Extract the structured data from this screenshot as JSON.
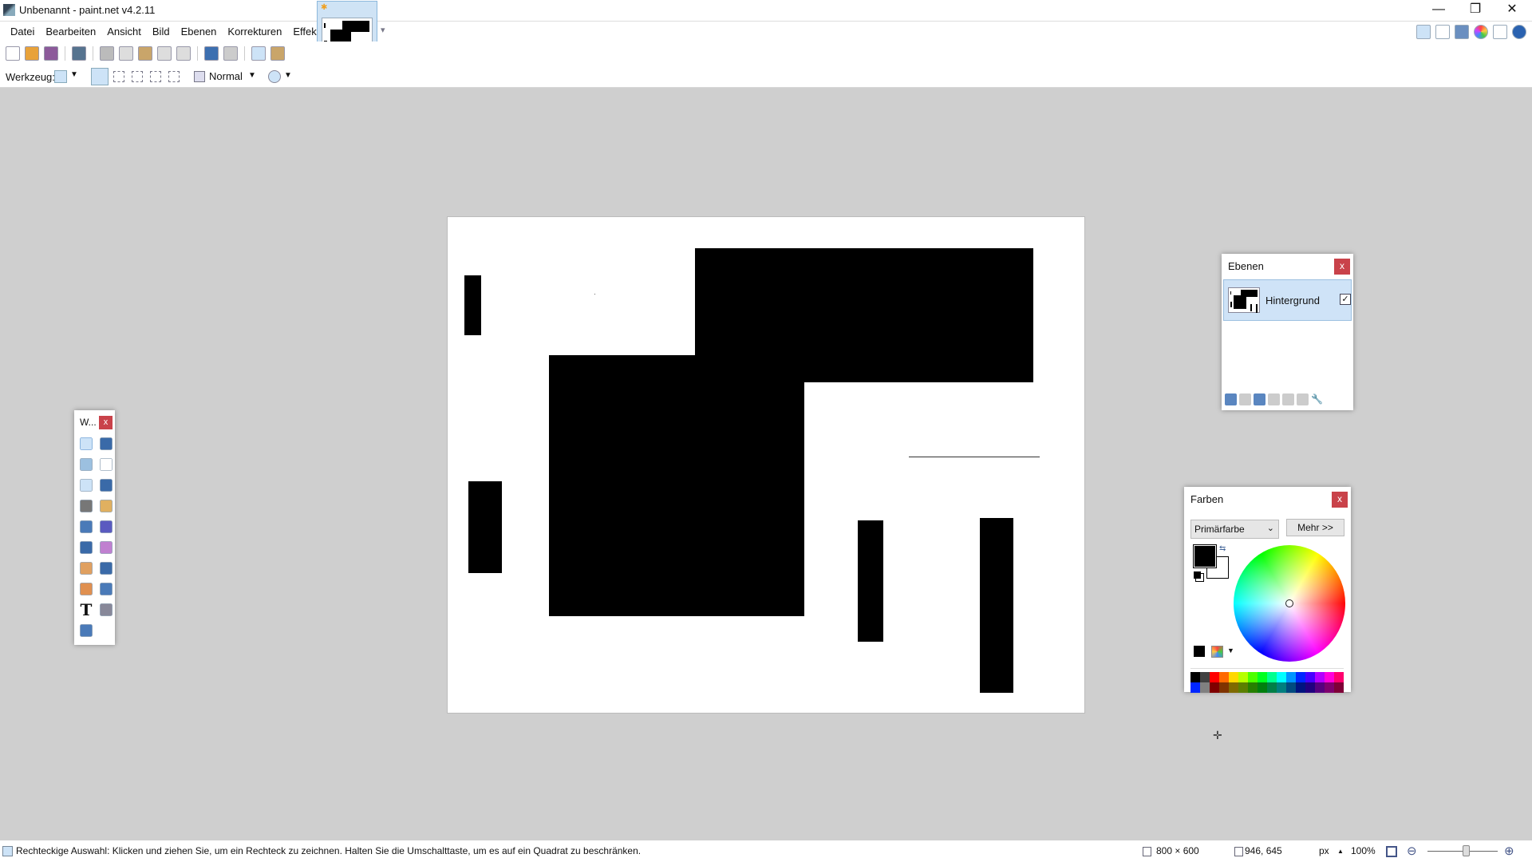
{
  "window": {
    "title": "Unbenannt - paint.net v4.2.11",
    "minimize": "—",
    "restore": "❐",
    "close": "✕"
  },
  "menu": [
    {
      "label": "Datei"
    },
    {
      "label": "Bearbeiten"
    },
    {
      "label": "Ansicht"
    },
    {
      "label": "Bild"
    },
    {
      "label": "Ebenen"
    },
    {
      "label": "Korrekturen"
    },
    {
      "label": "Effekte"
    }
  ],
  "toolbar": {
    "icons": [
      "new-file",
      "open-file",
      "save",
      "print",
      "cut",
      "copy",
      "paste",
      "crop",
      "delete",
      "undo",
      "redo",
      "grid",
      "ruler"
    ],
    "tool_label": "Werkzeug:",
    "blend_mode": "Normal"
  },
  "top_right_icons": [
    "tools-window",
    "history-window",
    "layers-window",
    "colors-window",
    "settings",
    "help"
  ],
  "layers_panel": {
    "title": "Ebenen",
    "close": "x",
    "layers": [
      {
        "name": "Hintergrund",
        "visible": true
      }
    ],
    "buttons": [
      "add-layer",
      "delete-layer",
      "duplicate-layer",
      "merge-layer-down",
      "move-layer-up",
      "move-layer-down",
      "layer-properties"
    ]
  },
  "colors_panel": {
    "title": "Farben",
    "close": "x",
    "mode": "Primärfarbe",
    "more": "Mehr >>",
    "primary": "#000000",
    "secondary": "#ffffff",
    "palette_top": [
      "#000000",
      "#404040",
      "#ff0000",
      "#ff6a00",
      "#ffd800",
      "#b6ff00",
      "#4cff00",
      "#00ff21",
      "#00ff90",
      "#00ffff",
      "#0094ff",
      "#0026ff",
      "#4800ff",
      "#b200ff",
      "#ff00dc",
      "#ff006e"
    ],
    "palette_bottom": [
      "#0026ff",
      "#808080",
      "#7f0000",
      "#7f3300",
      "#7f6a00",
      "#5b7f00",
      "#267f00",
      "#007f0e",
      "#007f46",
      "#007f7f",
      "#004a7f",
      "#00137f",
      "#21007f",
      "#57007f",
      "#7f006e",
      "#7f0037"
    ]
  },
  "tools_window": {
    "title": "W...",
    "close": "x",
    "tools": [
      "rectangle-select",
      "move-selection",
      "lasso-select",
      "move-selected",
      "ellipse-select",
      "zoom",
      "magic-wand",
      "pan",
      "paint-bucket",
      "gradient",
      "paintbrush",
      "eraser",
      "pencil",
      "color-picker",
      "clone-stamp",
      "recolor",
      "text",
      "line-curve",
      "shapes"
    ]
  },
  "status": {
    "hint": "Rechteckige Auswahl: Klicken und ziehen Sie, um ein Rechteck zu zeichnen. Halten Sie die Umschalttaste, um es auf ein Quadrat zu beschränken.",
    "image_size": "800 × 600",
    "cursor_pos": "946, 645",
    "units": "px",
    "zoom": "100%",
    "zoom_slider": 0.55
  }
}
